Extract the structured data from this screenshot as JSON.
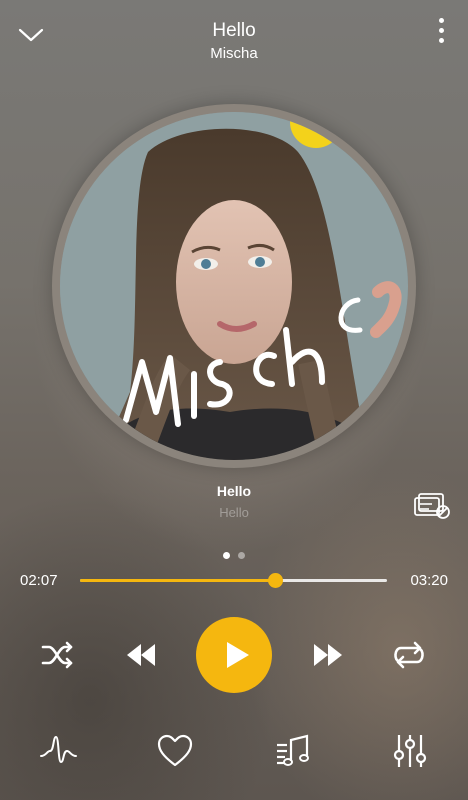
{
  "header": {
    "title": "Hello",
    "artist": "Mischa"
  },
  "album_art": {
    "watermark_text": "Mischa"
  },
  "caption": {
    "title": "Hello",
    "subtitle": "Hello"
  },
  "pager": {
    "count": 2,
    "active": 0
  },
  "progress": {
    "current": "02:07",
    "total": "03:20",
    "fraction": 0.635
  },
  "icons": {
    "top_left": "chevron-down-icon",
    "top_right": "more-vertical-icon",
    "lyrics": "lyrics-off-icon",
    "shuffle": "shuffle-icon",
    "prev": "rewind-icon",
    "play": "play-icon",
    "next": "fast-forward-icon",
    "repeat": "repeat-icon",
    "visualizer": "waveform-icon",
    "favorite": "heart-icon",
    "playlist": "music-queue-icon",
    "equalizer": "equalizer-icon"
  },
  "colors": {
    "accent": "#f5b70f",
    "text": "#ffffff"
  }
}
